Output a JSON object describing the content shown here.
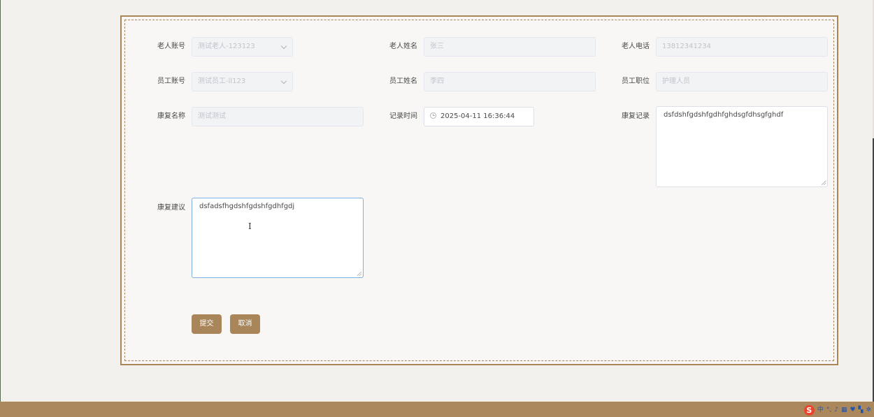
{
  "form": {
    "elder_account": {
      "label": "老人账号",
      "value": "测试老人-123123"
    },
    "elder_name": {
      "label": "老人姓名",
      "value": "张三"
    },
    "elder_phone": {
      "label": "老人电话",
      "value": "13812341234"
    },
    "staff_account": {
      "label": "员工账号",
      "value": "测试员工-ll123"
    },
    "staff_name": {
      "label": "员工姓名",
      "value": "李四"
    },
    "staff_position": {
      "label": "员工职位",
      "value": "护理人员"
    },
    "rehab_name": {
      "label": "康复名称",
      "value": "测试测试"
    },
    "record_time": {
      "label": "记录时间",
      "value": "2025-04-11 16:36:44"
    },
    "rehab_record": {
      "label": "康复记录",
      "value": "dsfdshfgdshfgdhfghdsgfdhsgfghdf"
    },
    "rehab_advice": {
      "label": "康复建议",
      "value": "dsfadsfhgdshfgdshfgdhfgdj"
    }
  },
  "buttons": {
    "submit": "提交",
    "cancel": "取消"
  },
  "tray": {
    "lang": "中",
    "punct": "°,",
    "icons": [
      "sogou-icon",
      "mic-icon",
      "keyboard-icon",
      "skin-icon",
      "apps-icon",
      "settings-icon"
    ]
  },
  "colors": {
    "accent": "#a8865a",
    "footer": "#ab885c",
    "focus": "#7fb1e5"
  }
}
